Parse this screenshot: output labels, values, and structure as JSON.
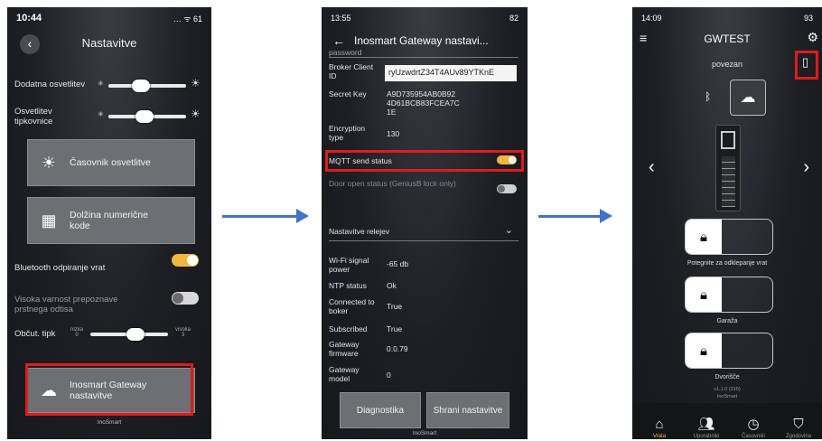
{
  "screen1": {
    "status_time": "10:44",
    "status_right": "… ᯤ 61",
    "title": "Nastavitve",
    "extra_light_label": "Dodatna osvetlitev",
    "extra_light_level": 0.4,
    "keypad_light_label": "Osvetlitev tipkovnice",
    "keypad_light_level": 0.45,
    "timer_button": "Časovnik osvetlitve",
    "code_length_button": "Dolžina numerične kode",
    "bluetooth_label": "Bluetooth odpiranje vrat",
    "bluetooth_on": true,
    "high_security_label": "Visoka varnost prepoznave prstnega odtisa",
    "high_security_on": false,
    "sensitivity_label": "Občut. tipk",
    "sensitivity_low": "nizka",
    "sensitivity_low_value": "0",
    "sensitivity_high": "visoka",
    "sensitivity_high_value": "3",
    "sensitivity_level": 0.6,
    "gateway_button": "Inosmart Gateway nastavitve",
    "brand": "InoSmart"
  },
  "screen2": {
    "status_time": "13:55",
    "status_right": "82",
    "title": "Inosmart Gateway nastavi...",
    "password_label": "password",
    "broker_client_id_label": "Broker Client ID",
    "broker_client_id_value": "ryUzwdrtZ34T4AUv89YTKnE",
    "secret_key_label": "Secret Key",
    "secret_key_value": "A9D735954AB0B92 4D61BCB83FCEA7C 1E",
    "encryption_label": "Encryption type",
    "encryption_value": "130",
    "mqtt_label": "MQTT send status",
    "mqtt_on": true,
    "door_status_label": "Door open status (GeniusB lock only)",
    "door_status_on": false,
    "relay_dropdown": "Nastavitve relejev",
    "wifi_label": "Wi-Fi signal power",
    "wifi_value": "-65 db",
    "ntp_label": "NTP status",
    "ntp_value": "Ok",
    "connected_label": "Connected to boker",
    "connected_value": "True",
    "subscribed_label": "Subscribed",
    "subscribed_value": "True",
    "firmware_label": "Gateway firmware",
    "firmware_value": "0.0.79",
    "model_label": "Gateway model",
    "model_value": "0",
    "diag_button": "Diagnostika",
    "save_button": "Shrani nastavitve",
    "brand": "InoSmart"
  },
  "screen3": {
    "status_time": "14:09",
    "status_right": "93",
    "title": "GWTEST",
    "connection_status": "povezan",
    "lock1_caption": "Potegnite za odklepanje vrat",
    "lock2_caption": "Garaža",
    "lock3_caption": "Dvorišče",
    "version": "v1.1.0 (316)",
    "brand": "InoSmart",
    "nav": [
      {
        "label": "Vrata",
        "icon": "home-icon"
      },
      {
        "label": "Uporabniki",
        "icon": "users-icon"
      },
      {
        "label": "Časovniki",
        "icon": "timers-icon"
      },
      {
        "label": "Zgodovina",
        "icon": "history-icon"
      }
    ]
  },
  "colors": {
    "highlight": "#e01b1b",
    "accent": "#f2b640",
    "arrow": "#4472c4"
  }
}
